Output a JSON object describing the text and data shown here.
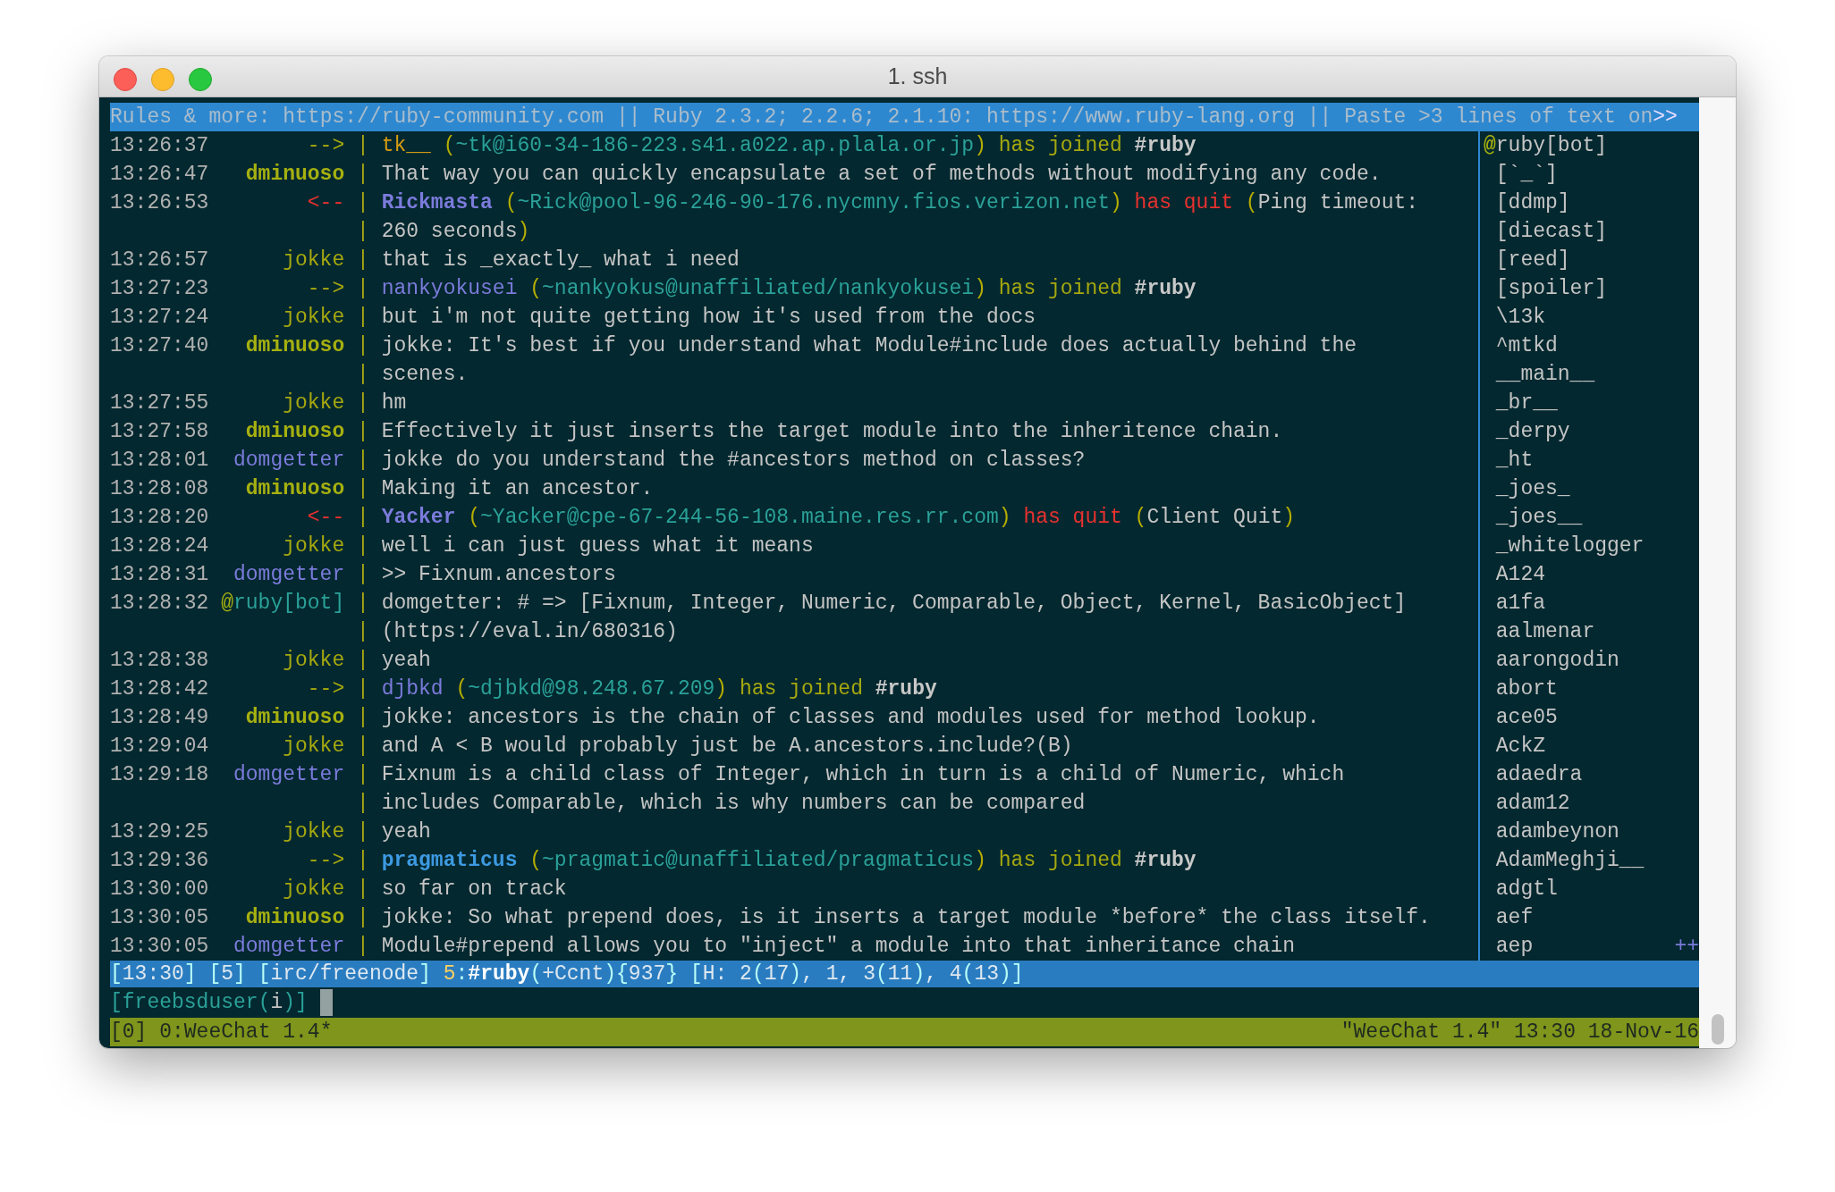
{
  "window": {
    "title": "1. ssh"
  },
  "topic": {
    "text": "Rules & more: https://ruby-community.com || Ruby 2.3.2; 2.2.6; 2.1.10: https://www.ruby-lang.org || Paste >3 lines of text on",
    "overflow": ">>"
  },
  "chat": {
    "rows": [
      {
        "time": "13:26:37",
        "nick": [
          {
            "text": "-->",
            "color": "#a6a80f"
          }
        ],
        "sep": "|",
        "parts": [
          {
            "text": "tk__",
            "color": "#d69b12"
          },
          {
            "text": " (",
            "color": "#b5ad00"
          },
          {
            "text": "~tk@i60-34-186-223.s41.a022.ap.plala.or.jp",
            "color": "#2aa198"
          },
          {
            "text": ")",
            "color": "#b5ad00"
          },
          {
            "text": " has joined ",
            "color": "#a6a80f"
          },
          {
            "text": "#ruby",
            "color": "#c8c8c8",
            "bold": true
          }
        ]
      },
      {
        "time": "13:26:47",
        "nick": [
          {
            "text": "dminuoso",
            "color": "#a6b010",
            "bold": true
          }
        ],
        "sep": "|",
        "parts": [
          {
            "text": "That way you can quickly encapsulate a set of methods without modifying any code.",
            "color": "#c4c4c4"
          }
        ]
      },
      {
        "time": "13:26:53",
        "nick": [
          {
            "text": "<--",
            "color": "#e8312f"
          }
        ],
        "sep": "|",
        "parts": [
          {
            "text": "Rickmasta",
            "color": "#7b7bdb",
            "bold": true
          },
          {
            "text": " (",
            "color": "#b5ad00"
          },
          {
            "text": "~Rick@pool-96-246-90-176.nycmny.fios.verizon.net",
            "color": "#2aa198"
          },
          {
            "text": ")",
            "color": "#b5ad00"
          },
          {
            "text": " has quit ",
            "color": "#e8312f"
          },
          {
            "text": "(",
            "color": "#b5ad00"
          },
          {
            "text": "Ping timeout:",
            "color": "#c4c4c4"
          }
        ]
      },
      {
        "sep": "|",
        "parts": [
          {
            "text": "260 seconds",
            "color": "#c4c4c4"
          },
          {
            "text": ")",
            "color": "#b5ad00"
          }
        ]
      },
      {
        "time": "13:26:57",
        "nick": [
          {
            "text": "jokke",
            "color": "#a6a80f"
          }
        ],
        "sep": "|",
        "parts": [
          {
            "text": "that is _exactly_ what i need",
            "color": "#c4c4c4"
          }
        ]
      },
      {
        "time": "13:27:23",
        "nick": [
          {
            "text": "-->",
            "color": "#a6a80f"
          }
        ],
        "sep": "|",
        "parts": [
          {
            "text": "nankyokusei",
            "color": "#7b7bdb"
          },
          {
            "text": " (",
            "color": "#b5ad00"
          },
          {
            "text": "~nankyokus@unaffiliated/nankyokusei",
            "color": "#2aa198"
          },
          {
            "text": ")",
            "color": "#b5ad00"
          },
          {
            "text": " has joined ",
            "color": "#a6a80f"
          },
          {
            "text": "#ruby",
            "color": "#c8c8c8",
            "bold": true
          }
        ]
      },
      {
        "time": "13:27:24",
        "nick": [
          {
            "text": "jokke",
            "color": "#a6a80f"
          }
        ],
        "sep": "|",
        "parts": [
          {
            "text": "but i'm not quite getting how it's used from the docs",
            "color": "#c4c4c4"
          }
        ]
      },
      {
        "time": "13:27:40",
        "nick": [
          {
            "text": "dminuoso",
            "color": "#a6b010",
            "bold": true
          }
        ],
        "sep": "|",
        "parts": [
          {
            "text": "jokke: It's best if you understand what Module#include does actually behind the",
            "color": "#c4c4c4"
          }
        ]
      },
      {
        "sep": "|",
        "parts": [
          {
            "text": "scenes.",
            "color": "#c4c4c4"
          }
        ]
      },
      {
        "time": "13:27:55",
        "nick": [
          {
            "text": "jokke",
            "color": "#a6a80f"
          }
        ],
        "sep": "|",
        "parts": [
          {
            "text": "hm",
            "color": "#c4c4c4"
          }
        ]
      },
      {
        "time": "13:27:58",
        "nick": [
          {
            "text": "dminuoso",
            "color": "#a6b010",
            "bold": true
          }
        ],
        "sep": "|",
        "parts": [
          {
            "text": "Effectively it just inserts the target module into the inheritence chain.",
            "color": "#c4c4c4"
          }
        ]
      },
      {
        "time": "13:28:01",
        "nick": [
          {
            "text": "domgetter",
            "color": "#7b7bdb"
          }
        ],
        "sep": "|",
        "parts": [
          {
            "text": "jokke do you understand the #ancestors method on classes?",
            "color": "#c4c4c4"
          }
        ]
      },
      {
        "time": "13:28:08",
        "nick": [
          {
            "text": "dminuoso",
            "color": "#a6b010",
            "bold": true
          }
        ],
        "sep": "|",
        "parts": [
          {
            "text": "Making it an ancestor.",
            "color": "#c4c4c4"
          }
        ]
      },
      {
        "time": "13:28:20",
        "nick": [
          {
            "text": "<--",
            "color": "#e8312f"
          }
        ],
        "sep": "|",
        "parts": [
          {
            "text": "Yacker",
            "color": "#7b7bdb",
            "bold": true
          },
          {
            "text": " (",
            "color": "#b5ad00"
          },
          {
            "text": "~Yacker@cpe-67-244-56-108.maine.res.rr.com",
            "color": "#2aa198"
          },
          {
            "text": ")",
            "color": "#b5ad00"
          },
          {
            "text": " has quit ",
            "color": "#e8312f"
          },
          {
            "text": "(",
            "color": "#b5ad00"
          },
          {
            "text": "Client Quit",
            "color": "#c4c4c4"
          },
          {
            "text": ")",
            "color": "#b5ad00"
          }
        ]
      },
      {
        "time": "13:28:24",
        "nick": [
          {
            "text": "jokke",
            "color": "#a6a80f"
          }
        ],
        "sep": "|",
        "parts": [
          {
            "text": "well i can just guess what it means",
            "color": "#c4c4c4"
          }
        ]
      },
      {
        "time": "13:28:31",
        "nick": [
          {
            "text": "domgetter",
            "color": "#7b7bdb"
          }
        ],
        "sep": "|",
        "parts": [
          {
            "text": ">> Fixnum.ancestors",
            "color": "#c4c4c4"
          }
        ]
      },
      {
        "time": "13:28:32",
        "nick": [
          {
            "text": "@",
            "color": "#a6b010"
          },
          {
            "text": "ruby[bot]",
            "color": "#2aa198"
          }
        ],
        "sep": "|",
        "parts": [
          {
            "text": "domgetter: # => [Fixnum, Integer, Numeric, Comparable, Object, Kernel, BasicObject]",
            "color": "#c4c4c4"
          }
        ]
      },
      {
        "sep": "|",
        "parts": [
          {
            "text": "(https://eval.in/680316)",
            "color": "#c4c4c4"
          }
        ]
      },
      {
        "time": "13:28:38",
        "nick": [
          {
            "text": "jokke",
            "color": "#a6a80f"
          }
        ],
        "sep": "|",
        "parts": [
          {
            "text": "yeah",
            "color": "#c4c4c4"
          }
        ]
      },
      {
        "time": "13:28:42",
        "nick": [
          {
            "text": "-->",
            "color": "#a6a80f"
          }
        ],
        "sep": "|",
        "parts": [
          {
            "text": "djbkd",
            "color": "#7b7bdb"
          },
          {
            "text": " (",
            "color": "#b5ad00"
          },
          {
            "text": "~djbkd@98.248.67.209",
            "color": "#2aa198"
          },
          {
            "text": ")",
            "color": "#b5ad00"
          },
          {
            "text": " has joined ",
            "color": "#a6a80f"
          },
          {
            "text": "#ruby",
            "color": "#c8c8c8",
            "bold": true
          }
        ]
      },
      {
        "time": "13:28:49",
        "nick": [
          {
            "text": "dminuoso",
            "color": "#a6b010",
            "bold": true
          }
        ],
        "sep": "|",
        "parts": [
          {
            "text": "jokke: ancestors is the chain of classes and modules used for method lookup.",
            "color": "#c4c4c4"
          }
        ]
      },
      {
        "time": "13:29:04",
        "nick": [
          {
            "text": "jokke",
            "color": "#a6a80f"
          }
        ],
        "sep": "|",
        "parts": [
          {
            "text": "and A < B would probably just be A.ancestors.include?(B)",
            "color": "#c4c4c4"
          }
        ]
      },
      {
        "time": "13:29:18",
        "nick": [
          {
            "text": "domgetter",
            "color": "#7b7bdb"
          }
        ],
        "sep": "|",
        "parts": [
          {
            "text": "Fixnum is a child class of Integer, which in turn is a child of Numeric, which",
            "color": "#c4c4c4"
          }
        ]
      },
      {
        "sep": "|",
        "parts": [
          {
            "text": "includes Comparable, which is why numbers can be compared",
            "color": "#c4c4c4"
          }
        ]
      },
      {
        "time": "13:29:25",
        "nick": [
          {
            "text": "jokke",
            "color": "#a6a80f"
          }
        ],
        "sep": "|",
        "parts": [
          {
            "text": "yeah",
            "color": "#c4c4c4"
          }
        ]
      },
      {
        "time": "13:29:36",
        "nick": [
          {
            "text": "-->",
            "color": "#a6a80f"
          }
        ],
        "sep": "|",
        "parts": [
          {
            "text": "pragmaticus",
            "color": "#3d9ae2",
            "bold": true
          },
          {
            "text": " (",
            "color": "#b5ad00"
          },
          {
            "text": "~pragmatic@unaffiliated/pragmaticus",
            "color": "#2aa198"
          },
          {
            "text": ")",
            "color": "#b5ad00"
          },
          {
            "text": " has joined ",
            "color": "#a6a80f"
          },
          {
            "text": "#ruby",
            "color": "#c8c8c8",
            "bold": true
          }
        ]
      },
      {
        "time": "13:30:00",
        "nick": [
          {
            "text": "jokke",
            "color": "#a6a80f"
          }
        ],
        "sep": "|",
        "parts": [
          {
            "text": "so far on track",
            "color": "#c4c4c4"
          }
        ]
      },
      {
        "time": "13:30:05",
        "nick": [
          {
            "text": "dminuoso",
            "color": "#a6b010",
            "bold": true
          }
        ],
        "sep": "|",
        "parts": [
          {
            "text": "jokke: So what prepend does, is it inserts a target module *before* the class itself.",
            "color": "#c4c4c4"
          }
        ]
      },
      {
        "time": "13:30:05",
        "nick": [
          {
            "text": "domgetter",
            "color": "#7b7bdb"
          }
        ],
        "sep": "|",
        "parts": [
          {
            "text": "Module#prepend allows you to \"inject\" a module into that inheritance chain",
            "color": "#c4c4c4"
          }
        ]
      }
    ]
  },
  "nicklist": {
    "items": [
      {
        "mode": "@",
        "name": "ruby[bot]"
      },
      {
        "name": "[`_`]"
      },
      {
        "name": "[ddmp]"
      },
      {
        "name": "[diecast]"
      },
      {
        "name": "[reed]"
      },
      {
        "name": "[spoiler]"
      },
      {
        "name": "\\13k"
      },
      {
        "name": "^mtkd"
      },
      {
        "name": "__main__"
      },
      {
        "name": "_br__"
      },
      {
        "name": "_derpy"
      },
      {
        "name": "_ht"
      },
      {
        "name": "_joes_"
      },
      {
        "name": "_joes__"
      },
      {
        "name": "_whitelogger"
      },
      {
        "name": "A124"
      },
      {
        "name": "a1fa"
      },
      {
        "name": "aalmenar"
      },
      {
        "name": "aarongodin"
      },
      {
        "name": "abort"
      },
      {
        "name": "ace05"
      },
      {
        "name": "AckZ"
      },
      {
        "name": "adaedra"
      },
      {
        "name": "adam12"
      },
      {
        "name": "adambeynon"
      },
      {
        "name": "AdamMeghji__"
      },
      {
        "name": "adgtl"
      },
      {
        "name": "aef"
      },
      {
        "name": "aep"
      }
    ],
    "more": "++"
  },
  "status_bar": {
    "parts": [
      {
        "text": "[",
        "color": "#b8fff6"
      },
      {
        "text": "13:30",
        "color": "#dde8f0"
      },
      {
        "text": "] [",
        "color": "#b8fff6"
      },
      {
        "text": "5",
        "color": "#dde8f0"
      },
      {
        "text": "] [",
        "color": "#b8fff6"
      },
      {
        "text": "irc/freenode",
        "color": "#dde8f0"
      },
      {
        "text": "] ",
        "color": "#b8fff6"
      },
      {
        "text": "5",
        "color": "#ffd060"
      },
      {
        "text": ":",
        "color": "#b8fff6"
      },
      {
        "text": "#ruby",
        "color": "#ffffff",
        "bold": true
      },
      {
        "text": "(",
        "color": "#b8fff6"
      },
      {
        "text": "+Ccnt",
        "color": "#dde8f0"
      },
      {
        "text": ")",
        "color": "#b8fff6"
      },
      {
        "text": "{",
        "color": "#b8fff6"
      },
      {
        "text": "937",
        "color": "#dde8f0"
      },
      {
        "text": "} [",
        "color": "#b8fff6"
      },
      {
        "text": "H: 2",
        "color": "#dde8f0"
      },
      {
        "text": "(",
        "color": "#b8fff6"
      },
      {
        "text": "17",
        "color": "#dde8f0"
      },
      {
        "text": ")",
        "color": "#b8fff6"
      },
      {
        "text": ", 1, 3",
        "color": "#dde8f0"
      },
      {
        "text": "(",
        "color": "#b8fff6"
      },
      {
        "text": "11",
        "color": "#dde8f0"
      },
      {
        "text": ")",
        "color": "#b8fff6"
      },
      {
        "text": ", 4",
        "color": "#dde8f0"
      },
      {
        "text": "(",
        "color": "#b8fff6"
      },
      {
        "text": "13",
        "color": "#dde8f0"
      },
      {
        "text": ")]",
        "color": "#b8fff6"
      }
    ]
  },
  "input": {
    "prompt": [
      {
        "text": "[freebsduser(",
        "color": "#2aa198"
      },
      {
        "text": "i",
        "color": "#c4c4c4"
      },
      {
        "text": ")]",
        "color": "#2aa198"
      }
    ]
  },
  "tmux_bar": {
    "left": "[0] 0:WeeChat 1.4*",
    "right": "\"WeeChat 1.4\" 13:30 18-Nov-16"
  }
}
